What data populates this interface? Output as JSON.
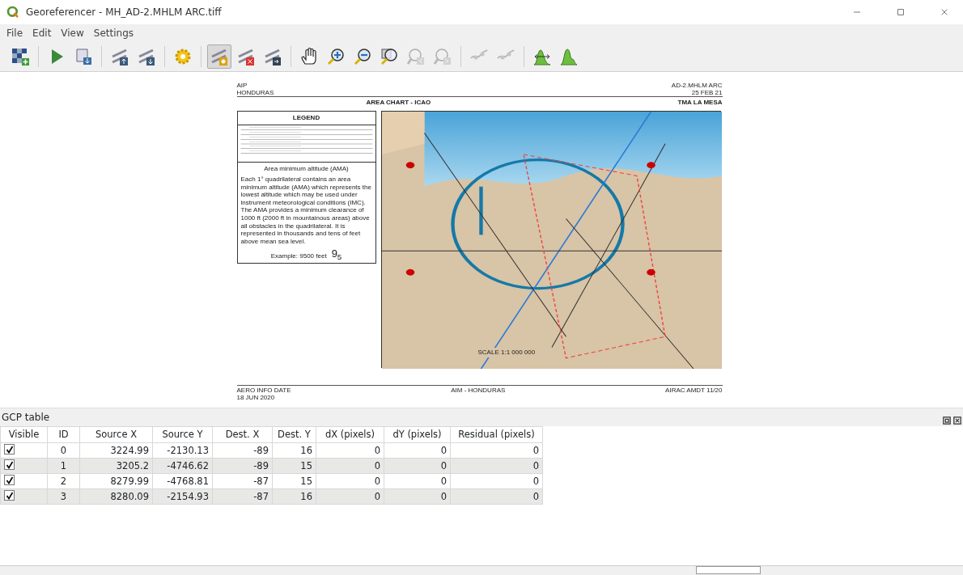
{
  "window": {
    "title": "Georeferencer - MH_AD-2.MHLM ARC.tiff"
  },
  "menu": [
    "File",
    "Edit",
    "View",
    "Settings"
  ],
  "toolbar": [
    {
      "kind": "raster",
      "selected": false,
      "disabled": false,
      "sep": false
    },
    {
      "kind": "play",
      "selected": false,
      "disabled": false,
      "sep": true
    },
    {
      "kind": "script",
      "selected": false,
      "disabled": false,
      "sep": false
    },
    {
      "kind": "loadpts",
      "selected": false,
      "disabled": false,
      "sep": true
    },
    {
      "kind": "savepts",
      "selected": false,
      "disabled": false,
      "sep": false
    },
    {
      "kind": "gear",
      "selected": false,
      "disabled": false,
      "sep": true
    },
    {
      "kind": "addpt",
      "selected": true,
      "disabled": false,
      "sep": true
    },
    {
      "kind": "delpt",
      "selected": false,
      "disabled": false,
      "sep": false
    },
    {
      "kind": "movept",
      "selected": false,
      "disabled": false,
      "sep": false
    },
    {
      "kind": "pan",
      "selected": false,
      "disabled": false,
      "sep": true
    },
    {
      "kind": "zoomin",
      "selected": false,
      "disabled": false,
      "sep": false
    },
    {
      "kind": "zoomout",
      "selected": false,
      "disabled": false,
      "sep": false
    },
    {
      "kind": "zoomlayer",
      "selected": false,
      "disabled": false,
      "sep": false
    },
    {
      "kind": "zoomlast",
      "selected": false,
      "disabled": true,
      "sep": false
    },
    {
      "kind": "zoomnext",
      "selected": false,
      "disabled": true,
      "sep": false
    },
    {
      "kind": "link",
      "selected": false,
      "disabled": true,
      "sep": true
    },
    {
      "kind": "link",
      "selected": false,
      "disabled": true,
      "sep": false
    },
    {
      "kind": "histfull",
      "selected": false,
      "disabled": false,
      "sep": true
    },
    {
      "kind": "histlocal",
      "selected": false,
      "disabled": false,
      "sep": false
    }
  ],
  "document": {
    "header_left": [
      "AIP",
      "HONDURAS"
    ],
    "header_right": [
      "AD-2.MHLM ARC",
      "25 FEB 21"
    ],
    "chart_title": "AREA CHART - ICAO",
    "chart_area": "TMA LA MESA",
    "legend": {
      "title": "LEGEND",
      "ama_title": "Area minimum altitude (AMA)",
      "ama_text": "Each 1° quadrilateral contains an area minimum altitude (AMA) which represents the lowest altitude which may be used under instrument meteorological conditions (IMC). The AMA provides a minimum clearance of 1000 ft (2000 ft in mountainous areas) above all obstacles in the quadrilateral. It is represented in thousands and tens of feet above mean sea level.",
      "example_label": "Example: 9500 feet",
      "example_value": "9$_{5}$"
    },
    "scale": "SCALE 1:1 000 000",
    "footer_left": [
      "AERO INFO DATE",
      "18 JUN 2020"
    ],
    "footer_center": "AIM - HONDURAS",
    "footer_right": "AIRAC AMDT 11/20"
  },
  "gcp_table": {
    "title": "GCP table",
    "columns": [
      "Visible",
      "ID",
      "Source X",
      "Source Y",
      "Dest. X",
      "Dest. Y",
      "dX (pixels)",
      "dY (pixels)",
      "Residual (pixels)"
    ],
    "rows": [
      {
        "visible": true,
        "cells": [
          "",
          "0",
          "3224.99",
          "-2130.13",
          "-89",
          "16",
          "0",
          "0",
          "0"
        ]
      },
      {
        "visible": true,
        "cells": [
          "",
          "1",
          "3205.2",
          "-4746.62",
          "-89",
          "15",
          "0",
          "0",
          "0"
        ]
      },
      {
        "visible": true,
        "cells": [
          "",
          "2",
          "8279.99",
          "-4768.81",
          "-87",
          "15",
          "0",
          "0",
          "0"
        ]
      },
      {
        "visible": true,
        "cells": [
          "",
          "3",
          "8280.09",
          "-2154.93",
          "-87",
          "16",
          "0",
          "0",
          "0"
        ]
      }
    ]
  }
}
